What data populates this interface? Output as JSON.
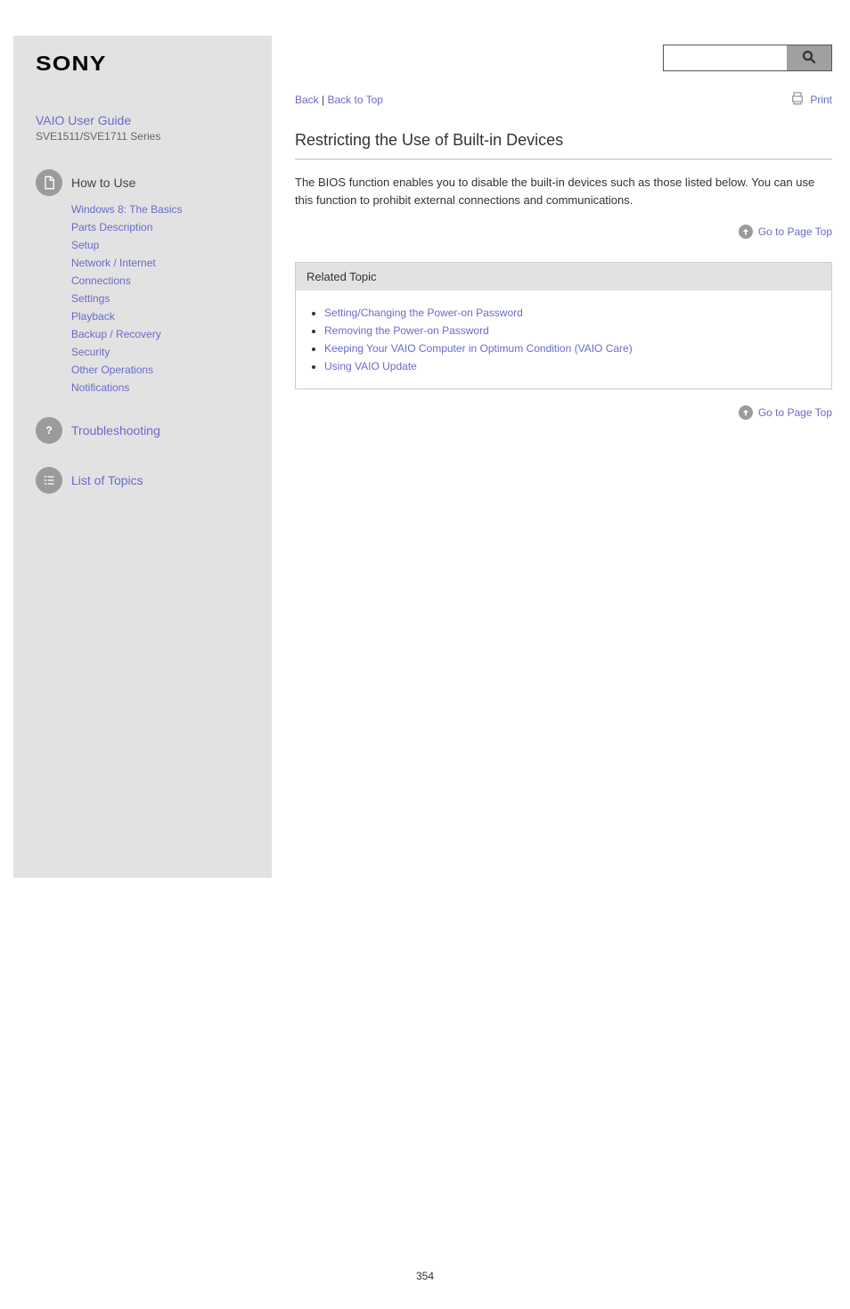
{
  "brand": "SONY",
  "product_link": "VAIO User Guide",
  "model": "SVE1511/SVE1711 Series",
  "search": {
    "placeholder": ""
  },
  "sidebar": {
    "how_to_use": {
      "label": "How to Use",
      "items": [
        {
          "label": "Windows 8: The Basics"
        },
        {
          "label": "Parts Description"
        },
        {
          "label": "Setup"
        },
        {
          "label": "Network / Internet"
        },
        {
          "label": "Connections"
        },
        {
          "label": "Settings"
        },
        {
          "label": "Playback"
        },
        {
          "label": "Backup / Recovery"
        },
        {
          "label": "Security"
        },
        {
          "label": "Other Operations"
        },
        {
          "label": "Notifications"
        }
      ]
    },
    "troubleshooting": {
      "label": "Troubleshooting"
    },
    "list_of_topics": {
      "label": "List of Topics"
    }
  },
  "breadcrumb": {
    "back": "Back",
    "sep": " | ",
    "back_to_top": "Back to Top"
  },
  "print_label": "Print",
  "article": {
    "title": "Restricting the Use of Built-in Devices",
    "body": "The BIOS function enables you to disable the built-in devices such as those listed below. You can use this function to prohibit external connections and communications."
  },
  "related": {
    "head": "Related Topic",
    "items": [
      {
        "label": "Setting/Changing the Power-on Password"
      },
      {
        "label": "Removing the Power-on Password"
      },
      {
        "label": "Keeping Your VAIO Computer in Optimum Condition (VAIO Care)"
      },
      {
        "label": "Using VAIO Update"
      }
    ]
  },
  "goto_page_top": "Go to Page Top",
  "page_number": "354"
}
